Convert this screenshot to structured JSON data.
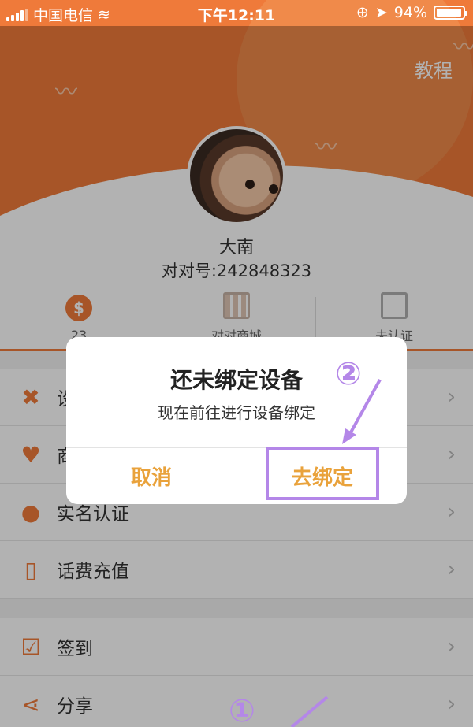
{
  "status_bar": {
    "carrier": "中国电信",
    "time": "下午12:11",
    "battery_percent": "94%"
  },
  "header": {
    "tutorial_label": "教程"
  },
  "profile": {
    "name": "大南",
    "account": "对对号:242848323"
  },
  "stats": [
    {
      "label": "23",
      "icon": "coin-icon"
    },
    {
      "label": "对对商城",
      "icon": "shop-icon"
    },
    {
      "label": "未认证",
      "icon": "id-card-icon"
    }
  ],
  "menu_group_1": [
    {
      "label": "设",
      "icon": "tools-icon"
    },
    {
      "label": "商",
      "icon": "heart-icon"
    },
    {
      "label": "实名认证",
      "icon": "user-verify-icon"
    },
    {
      "label": "话费充值",
      "icon": "phone-recharge-icon"
    }
  ],
  "menu_group_2": [
    {
      "label": "签到",
      "icon": "calendar-check-icon"
    },
    {
      "label": "分享",
      "icon": "share-icon"
    }
  ],
  "dialog": {
    "title": "还未绑定设备",
    "message": "现在前往进行设备绑定",
    "cancel_label": "取消",
    "confirm_label": "去绑定"
  },
  "annotations": {
    "step1": "①",
    "step2": "②",
    "color": "#b487e8"
  },
  "colors": {
    "accent": "#ef7a3a",
    "dialog_button": "#e9a23b"
  }
}
